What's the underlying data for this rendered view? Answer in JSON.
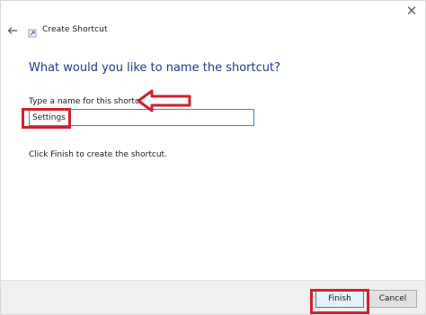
{
  "window": {
    "close_icon": "✕",
    "title": "Create Shortcut",
    "back_icon": "arrow-left-icon",
    "app_icon": "shortcut-icon"
  },
  "dialog": {
    "heading": "What would you like to name the shortcut?",
    "field_label": "Type a name for this shortcut:",
    "name_value": "Settings",
    "hint": "Click Finish to create the shortcut."
  },
  "buttons": {
    "finish": "Finish",
    "cancel": "Cancel"
  },
  "colors": {
    "heading": "#1e3a8a",
    "annotation": "#d0202e",
    "input_border": "#4a7fc0"
  }
}
